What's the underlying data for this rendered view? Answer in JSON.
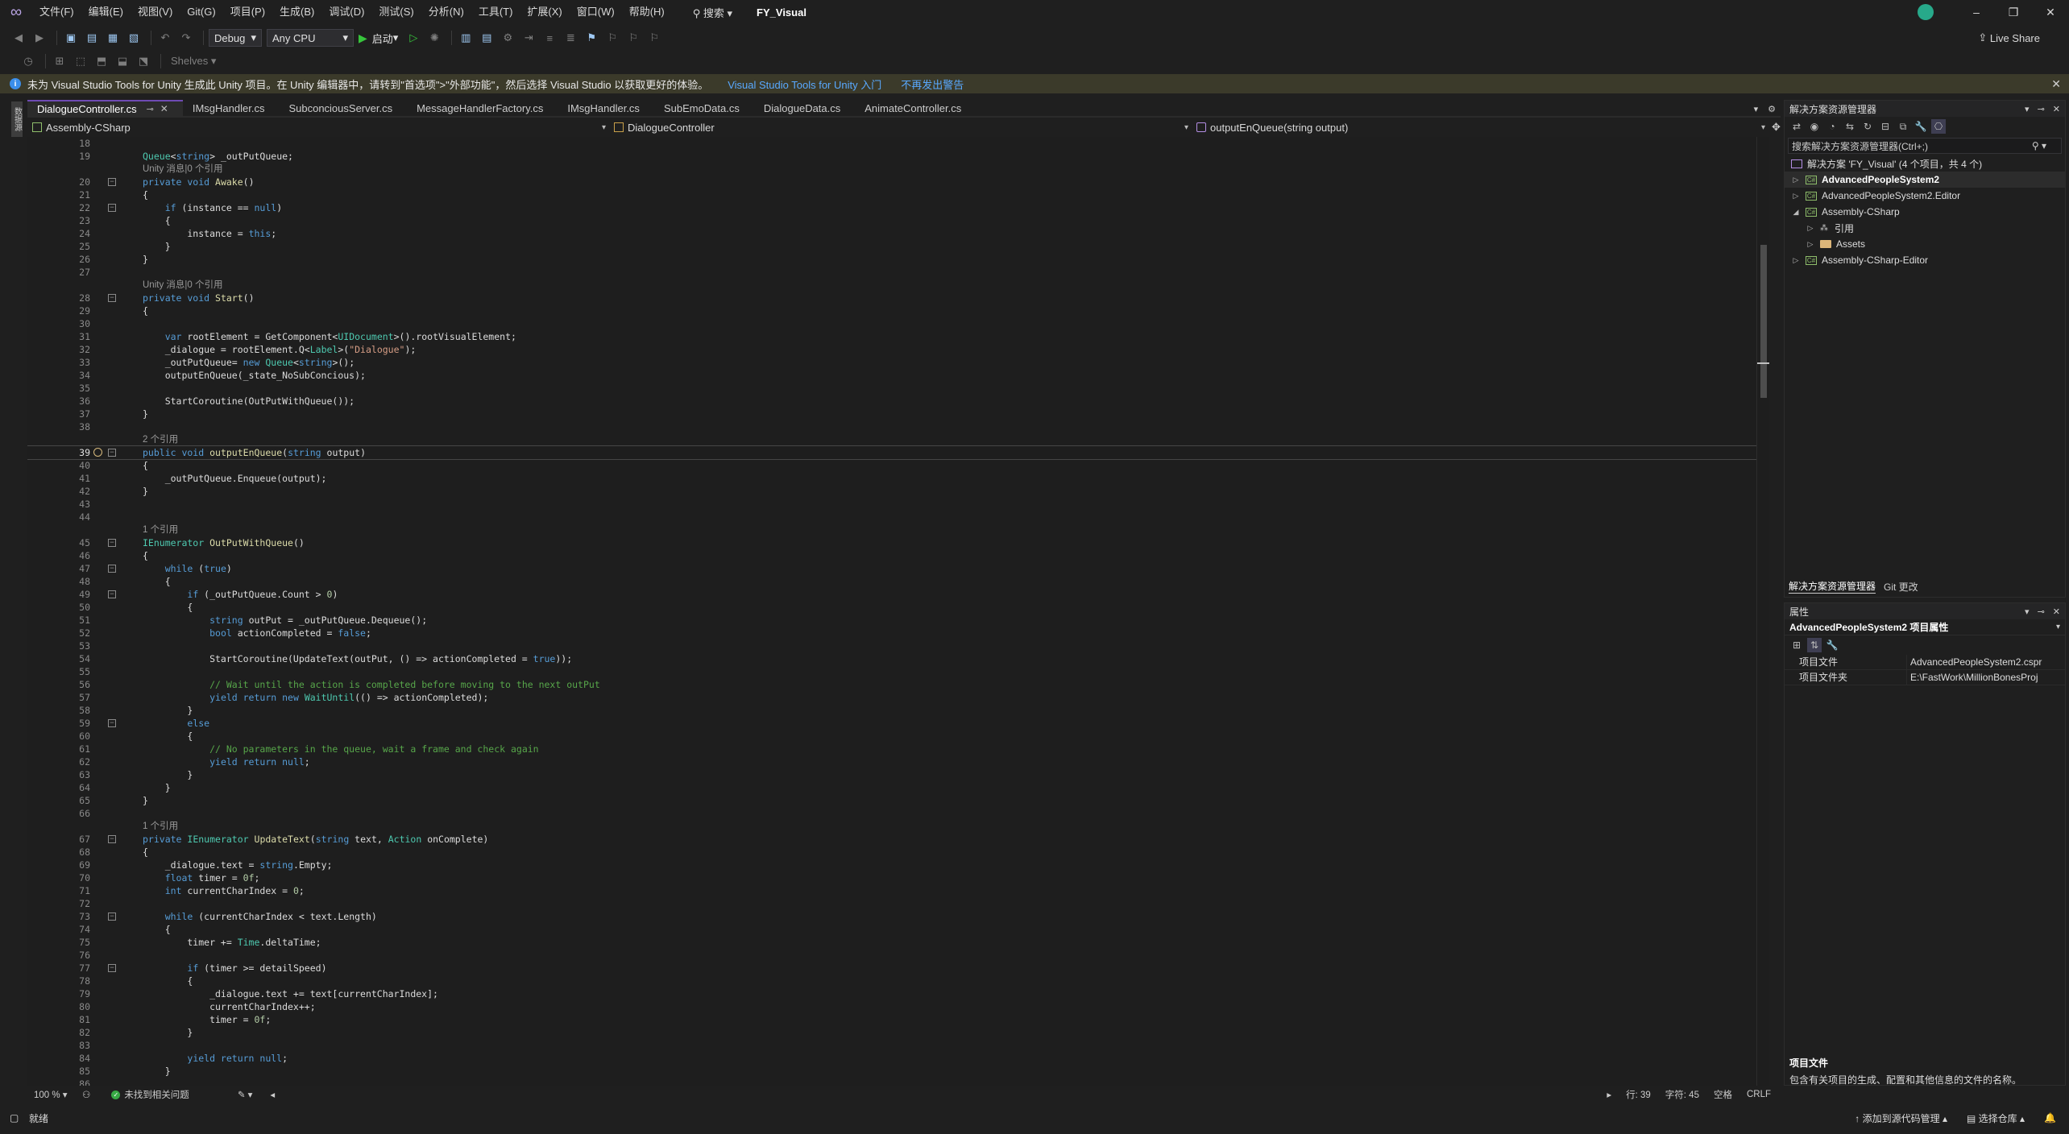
{
  "titlebar": {
    "menus": [
      "文件(F)",
      "编辑(E)",
      "视图(V)",
      "Git(G)",
      "项目(P)",
      "生成(B)",
      "调试(D)",
      "测试(S)",
      "分析(N)",
      "工具(T)",
      "扩展(X)",
      "窗口(W)",
      "帮助(H)"
    ],
    "search_label": "搜索",
    "app_title": "FY_Visual"
  },
  "toolbar": {
    "config": "Debug",
    "platform": "Any CPU",
    "run_label": "启动",
    "live_share": "Live Share",
    "shelves": "Shelves"
  },
  "infobar": {
    "message": "未为 Visual Studio Tools for Unity 生成此 Unity 项目。在 Unity 编辑器中，请转到\"首选项\">\"外部功能\"，然后选择 Visual Studio 以获取更好的体验。",
    "link1": "Visual Studio Tools for Unity 入门",
    "link2": "不再发出警告"
  },
  "side_strip": {
    "tab_label": "数据源"
  },
  "doc_tabs": [
    {
      "label": "DialogueController.cs",
      "active": true
    },
    {
      "label": "IMsgHandler.cs",
      "active": false
    },
    {
      "label": "SubconciousServer.cs",
      "active": false
    },
    {
      "label": "MessageHandlerFactory.cs",
      "active": false
    },
    {
      "label": "IMsgHandler.cs",
      "active": false
    },
    {
      "label": "SubEmoData.cs",
      "active": false
    },
    {
      "label": "DialogueData.cs",
      "active": false
    },
    {
      "label": "AnimateController.cs",
      "active": false
    }
  ],
  "navbar": {
    "project": "Assembly-CSharp",
    "class": "DialogueController",
    "member": "outputEnQueue(string output)"
  },
  "code_lines": [
    {
      "n": "18",
      "html": ""
    },
    {
      "n": "19",
      "html": "<span class='t'>Queue</span>&lt;<span class='k'>string</span>&gt; _outPutQueue;"
    },
    {
      "n": "",
      "lens": true,
      "html": "Unity 消息|0 个引用"
    },
    {
      "n": "20",
      "fold": true,
      "html": "<span class='k'>private void</span> <span class='m'>Awake</span>()"
    },
    {
      "n": "21",
      "html": "{"
    },
    {
      "n": "22",
      "fold": true,
      "html": "    <span class='k'>if</span> (instance == <span class='k'>null</span>)"
    },
    {
      "n": "23",
      "html": "    {"
    },
    {
      "n": "24",
      "html": "        instance = <span class='k'>this</span>;"
    },
    {
      "n": "25",
      "html": "    }"
    },
    {
      "n": "26",
      "html": "}"
    },
    {
      "n": "27",
      "html": ""
    },
    {
      "n": "",
      "lens": true,
      "html": "Unity 消息|0 个引用"
    },
    {
      "n": "28",
      "fold": true,
      "html": "<span class='k'>private void</span> <span class='m'>Start</span>()"
    },
    {
      "n": "29",
      "html": "{"
    },
    {
      "n": "30",
      "html": ""
    },
    {
      "n": "31",
      "html": "    <span class='k'>var</span> rootElement = GetComponent&lt;<span class='t'>UIDocument</span>&gt;().rootVisualElement;"
    },
    {
      "n": "32",
      "html": "    _dialogue = rootElement.Q&lt;<span class='t'>Label</span>&gt;(<span class='s'>\"Dialogue\"</span>);"
    },
    {
      "n": "33",
      "html": "    _outPutQueue= <span class='k'>new</span> <span class='t'>Queue</span>&lt;<span class='k'>string</span>&gt;();"
    },
    {
      "n": "34",
      "html": "    outputEnQueue(_state_NoSubConcious);"
    },
    {
      "n": "35",
      "html": ""
    },
    {
      "n": "36",
      "html": "    StartCoroutine(OutPutWithQueue());"
    },
    {
      "n": "37",
      "html": "}"
    },
    {
      "n": "38",
      "html": ""
    },
    {
      "n": "",
      "lens": true,
      "html": "2 个引用"
    },
    {
      "n": "39",
      "fold": true,
      "cur": true,
      "html": "<span class='k'>public void</span> <span class='m'>outputEnQueue</span>(<span class='k'>string</span> output)"
    },
    {
      "n": "40",
      "html": "{"
    },
    {
      "n": "41",
      "html": "    _outPutQueue.Enqueue(output);"
    },
    {
      "n": "42",
      "html": "}"
    },
    {
      "n": "43",
      "html": ""
    },
    {
      "n": "44",
      "html": ""
    },
    {
      "n": "",
      "lens": true,
      "html": "1 个引用"
    },
    {
      "n": "45",
      "fold": true,
      "html": "<span class='t'>IEnumerator</span> <span class='m'>OutPutWithQueue</span>()"
    },
    {
      "n": "46",
      "html": "{"
    },
    {
      "n": "47",
      "fold": true,
      "html": "    <span class='k'>while</span> (<span class='k'>true</span>)"
    },
    {
      "n": "48",
      "html": "    {"
    },
    {
      "n": "49",
      "fold": true,
      "html": "        <span class='k'>if</span> (_outPutQueue.Count &gt; <span class='n'>0</span>)"
    },
    {
      "n": "50",
      "html": "        {"
    },
    {
      "n": "51",
      "html": "            <span class='k'>string</span> outPut = _outPutQueue.Dequeue();"
    },
    {
      "n": "52",
      "html": "            <span class='k'>bool</span> actionCompleted = <span class='k'>false</span>;"
    },
    {
      "n": "53",
      "html": ""
    },
    {
      "n": "54",
      "html": "            StartCoroutine(UpdateText(outPut, () =&gt; actionCompleted = <span class='k'>true</span>));"
    },
    {
      "n": "55",
      "html": ""
    },
    {
      "n": "56",
      "html": "            <span class='c'>// Wait until the action is completed before moving to the next outPut</span>"
    },
    {
      "n": "57",
      "html": "            <span class='k'>yield return new</span> <span class='t'>WaitUntil</span>(() =&gt; actionCompleted);"
    },
    {
      "n": "58",
      "html": "        }"
    },
    {
      "n": "59",
      "fold": true,
      "html": "        <span class='k'>else</span>"
    },
    {
      "n": "60",
      "html": "        {"
    },
    {
      "n": "61",
      "html": "            <span class='c'>// No parameters in the queue, wait a frame and check again</span>"
    },
    {
      "n": "62",
      "html": "            <span class='k'>yield return null</span>;"
    },
    {
      "n": "63",
      "html": "        }"
    },
    {
      "n": "64",
      "html": "    }"
    },
    {
      "n": "65",
      "html": "}"
    },
    {
      "n": "66",
      "html": ""
    },
    {
      "n": "",
      "lens": true,
      "html": "1 个引用"
    },
    {
      "n": "67",
      "fold": true,
      "html": "<span class='k'>private</span> <span class='t'>IEnumerator</span> <span class='m'>UpdateText</span>(<span class='k'>string</span> text, <span class='t'>Action</span> onComplete)"
    },
    {
      "n": "68",
      "html": "{"
    },
    {
      "n": "69",
      "html": "    _dialogue.text = <span class='k'>string</span>.Empty;"
    },
    {
      "n": "70",
      "html": "    <span class='k'>float</span> timer = <span class='n'>0f</span>;"
    },
    {
      "n": "71",
      "html": "    <span class='k'>int</span> currentCharIndex = <span class='n'>0</span>;"
    },
    {
      "n": "72",
      "html": ""
    },
    {
      "n": "73",
      "fold": true,
      "html": "    <span class='k'>while</span> (currentCharIndex &lt; text.Length)"
    },
    {
      "n": "74",
      "html": "    {"
    },
    {
      "n": "75",
      "html": "        timer += <span class='t'>Time</span>.deltaTime;"
    },
    {
      "n": "76",
      "html": ""
    },
    {
      "n": "77",
      "fold": true,
      "html": "        <span class='k'>if</span> (timer &gt;= detailSpeed)"
    },
    {
      "n": "78",
      "html": "        {"
    },
    {
      "n": "79",
      "html": "            _dialogue.text += text[currentCharIndex];"
    },
    {
      "n": "80",
      "html": "            currentCharIndex++;"
    },
    {
      "n": "81",
      "html": "            timer = <span class='n'>0f</span>;"
    },
    {
      "n": "82",
      "html": "        }"
    },
    {
      "n": "83",
      "html": ""
    },
    {
      "n": "84",
      "html": "        <span class='k'>yield return null</span>;"
    },
    {
      "n": "85",
      "html": "    }"
    },
    {
      "n": "86",
      "html": ""
    }
  ],
  "editor_status": {
    "zoom": "100 %",
    "issues": "未找到相关问题",
    "line": "行: 39",
    "col": "字符: 45",
    "ws": "空格",
    "eol": "CRLF"
  },
  "solution_explorer": {
    "title": "解决方案资源管理器",
    "search_placeholder": "搜索解决方案资源管理器(Ctrl+;)",
    "solution_label": "解决方案 'FY_Visual' (4 个项目，共 4 个)",
    "items": [
      {
        "label": "AdvancedPeopleSystem2",
        "level": 0,
        "bold": true,
        "arrow": "▷",
        "kind": "proj"
      },
      {
        "label": "AdvancedPeopleSystem2.Editor",
        "level": 0,
        "bold": false,
        "arrow": "▷",
        "kind": "proj"
      },
      {
        "label": "Assembly-CSharp",
        "level": 0,
        "bold": false,
        "arrow": "◢",
        "kind": "proj"
      },
      {
        "label": "引用",
        "level": 1,
        "bold": false,
        "arrow": "▷",
        "kind": "ref"
      },
      {
        "label": "Assets",
        "level": 1,
        "bold": false,
        "arrow": "▷",
        "kind": "folder"
      },
      {
        "label": "Assembly-CSharp-Editor",
        "level": 0,
        "bold": false,
        "arrow": "▷",
        "kind": "proj"
      }
    ],
    "tab1": "解决方案资源管理器",
    "tab2": "Git 更改"
  },
  "properties": {
    "title": "属性",
    "header": "AdvancedPeopleSystem2 项目属性",
    "rows": [
      {
        "key": "项目文件",
        "value": "AdvancedPeopleSystem2.cspr"
      },
      {
        "key": "项目文件夹",
        "value": "E:\\FastWork\\MillionBonesProj"
      }
    ],
    "desc_title": "项目文件",
    "desc_text": "包含有关项目的生成、配置和其他信息的文件的名称。"
  },
  "statusbar": {
    "ready": "就绪",
    "add_source": "添加到源代码管理",
    "select_repo": "选择仓库"
  }
}
